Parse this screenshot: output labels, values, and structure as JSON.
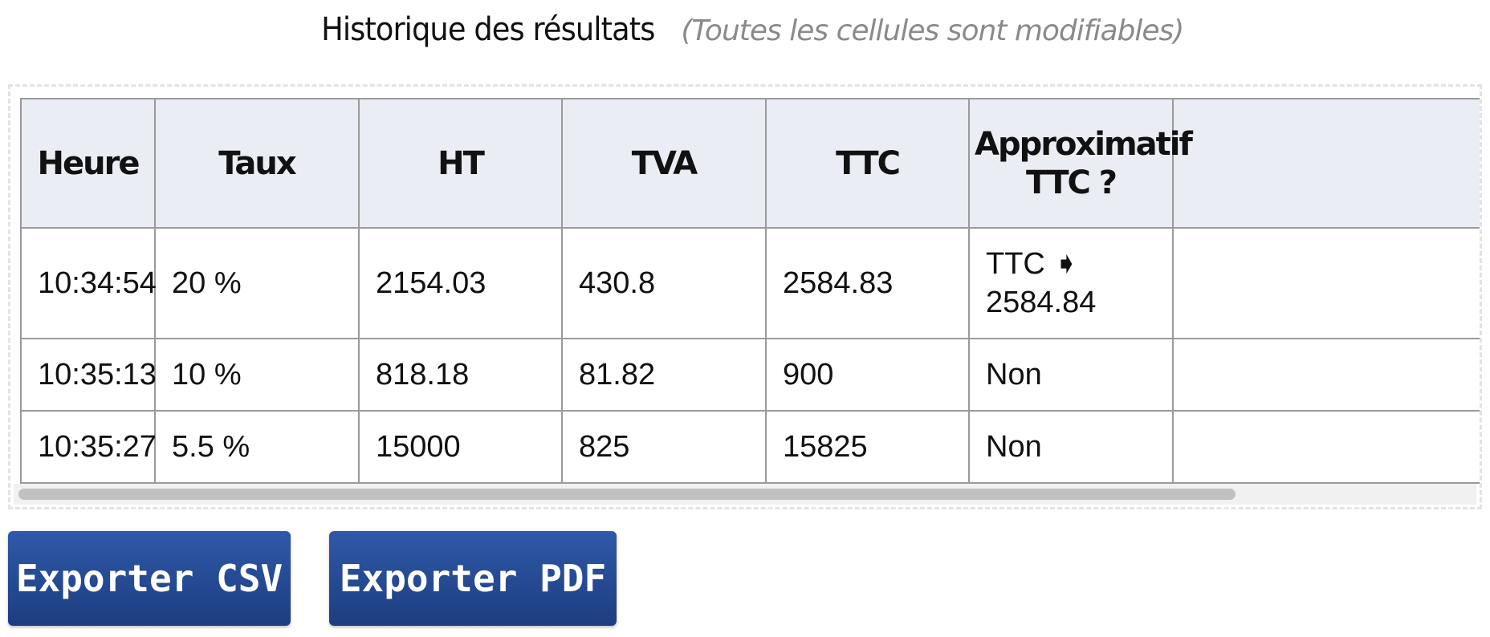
{
  "header": {
    "title": "Historique des résultats",
    "note": "(Toutes les cellules sont modifiables)"
  },
  "table": {
    "columns": [
      "Heure",
      "Taux",
      "HT",
      "TVA",
      "TTC",
      "Approximatif TTC ?"
    ],
    "column_approx_lines": [
      "Approximatif",
      "TTC ?"
    ],
    "rows": [
      {
        "heure": "10:34:54",
        "taux": "20 %",
        "ht": "2154.03",
        "tva": "430.8",
        "ttc": "2584.83",
        "approx_line1": "TTC ➧",
        "approx_line2": "2584.84"
      },
      {
        "heure": "10:35:13",
        "taux": "10 %",
        "ht": "818.18",
        "tva": "81.82",
        "ttc": "900",
        "approx": "Non"
      },
      {
        "heure": "10:35:27",
        "taux": "5.5 %",
        "ht": "15000",
        "tva": "825",
        "ttc": "15825",
        "approx": "Non"
      }
    ]
  },
  "actions": {
    "export_csv": "Exporter CSV",
    "export_pdf": "Exporter PDF"
  },
  "colors": {
    "header_bg": "#eaedf3",
    "button_bg": "#244a93",
    "border": "#9a9a9a"
  }
}
